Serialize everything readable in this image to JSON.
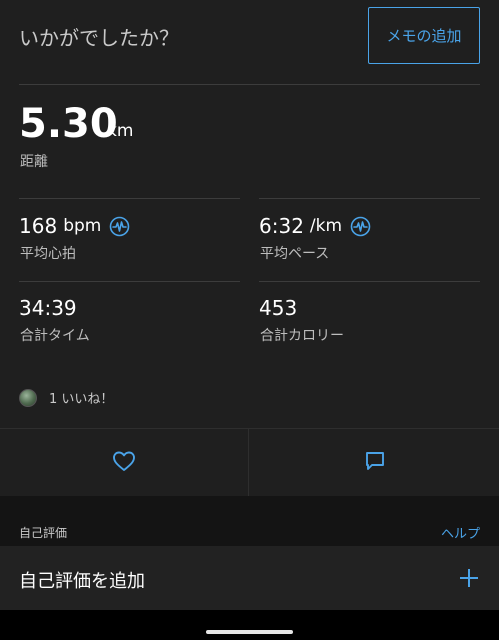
{
  "header": {
    "question": "いかがでしたか？",
    "memo_button": "メモの追加"
  },
  "distance": {
    "value": "5.30",
    "unit": "km",
    "label": "距離"
  },
  "stats": {
    "heart_rate": {
      "value": "168",
      "unit": "bpm",
      "label": "平均心拍",
      "icon": "heart-rate-icon"
    },
    "pace": {
      "value": "6:32",
      "unit": "/km",
      "label": "平均ペース",
      "icon": "heart-rate-icon"
    },
    "time": {
      "value": "34:39",
      "label": "合計タイム"
    },
    "calories": {
      "value": "453",
      "label": "合計カロリー"
    }
  },
  "likes": {
    "text": "1 いいね！"
  },
  "actions": {
    "like_icon": "heart-icon",
    "comment_icon": "comment-icon"
  },
  "self_eval": {
    "section_title": "自己評価",
    "help_link": "ヘルプ",
    "add_label": "自己評価を追加",
    "add_icon": "plus-icon"
  },
  "colors": {
    "accent": "#4aa3e8",
    "background": "#1e1e1e"
  }
}
